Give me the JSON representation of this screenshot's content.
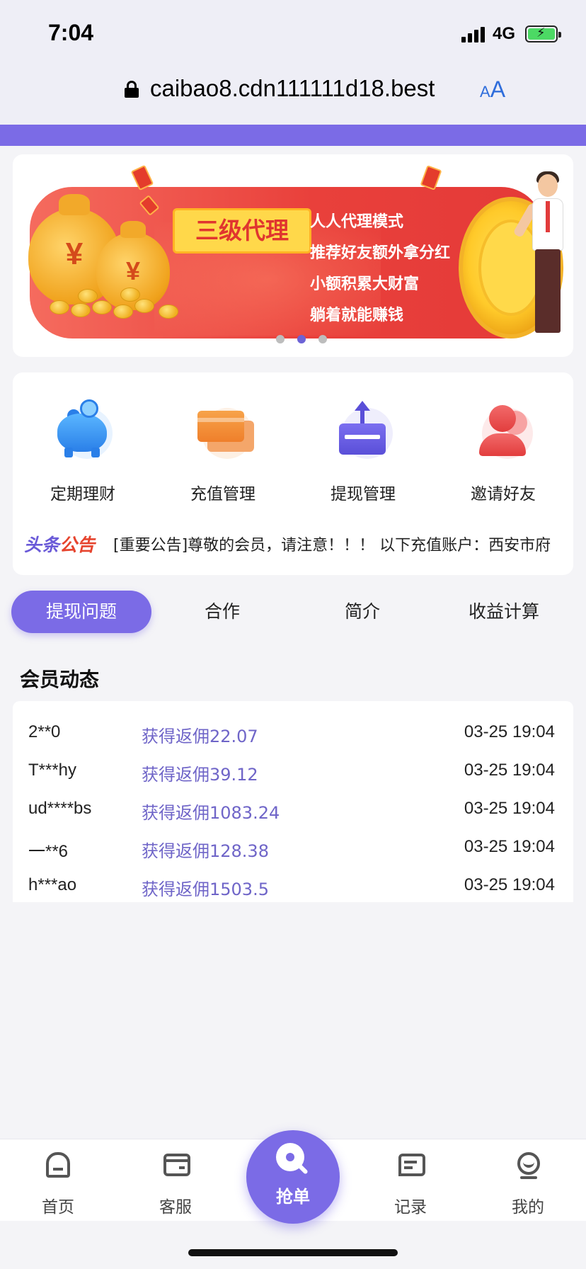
{
  "status_bar": {
    "time": "7:04",
    "network": "4G",
    "battery_state": "charging"
  },
  "browser": {
    "url": "caibao8.cdn111111d18.best",
    "text_size_label_small": "A",
    "text_size_label_big": "A"
  },
  "banner": {
    "badge": "三级代理",
    "lines": [
      "人人代理模式",
      "推荐好友额外拿分红",
      "小额积累大财富",
      "躺着就能赚钱"
    ],
    "coin_symbol": "¥",
    "slide_count": 3,
    "active_slide": 2
  },
  "quick_menu": {
    "items": [
      {
        "label": "定期理财",
        "icon": "piggy-bank-icon"
      },
      {
        "label": "充值管理",
        "icon": "credit-card-icon"
      },
      {
        "label": "提现管理",
        "icon": "withdraw-icon"
      },
      {
        "label": "邀请好友",
        "icon": "invite-friends-icon"
      }
    ]
  },
  "notice": {
    "label_part1": "头条",
    "label_part2": "公告",
    "text": "[重要公告]尊敬的会员，请注意！！！ 以下充值账户：西安市府"
  },
  "tabs": [
    {
      "label": "提现问题",
      "active": true
    },
    {
      "label": "合作",
      "active": false
    },
    {
      "label": "简介",
      "active": false
    },
    {
      "label": "收益计算",
      "active": false
    }
  ],
  "members": {
    "title": "会员动态",
    "rows": [
      {
        "user": "2**0",
        "reward": "获得返佣22.07",
        "time": "03-25 19:04"
      },
      {
        "user": "T***hy",
        "reward": "获得返佣39.12",
        "time": "03-25 19:04"
      },
      {
        "user": "ud****bs",
        "reward": "获得返佣1083.24",
        "time": "03-25 19:04"
      },
      {
        "user": "一**6",
        "reward": "获得返佣128.38",
        "time": "03-25 19:04"
      },
      {
        "user": "h***ao",
        "reward": "获得返佣1503.5",
        "time": "03-25 19:04"
      }
    ]
  },
  "bottom_nav": {
    "home": "首页",
    "service": "客服",
    "grab": "抢单",
    "records": "记录",
    "mine": "我的"
  },
  "colors": {
    "accent": "#7b6be6",
    "reward_text": "#6f65c8",
    "banner_red": "#e9403b",
    "notice_accent": "#e6442e"
  }
}
